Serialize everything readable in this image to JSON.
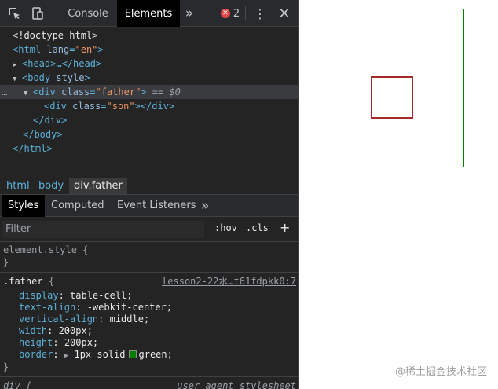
{
  "toolbar": {
    "tabs": [
      "Console",
      "Elements"
    ],
    "more": "»",
    "error_count": "2"
  },
  "dom": {
    "doctype": "<!doctype html>",
    "html_open_tag": "<html",
    "html_lang_attr": "lang",
    "html_lang_val": "\"en\"",
    "html_close_bracket": ">",
    "head_tag": "<head>…</head>",
    "body_open": "<body",
    "body_attr": "style",
    "body_close_bracket": ">",
    "div_open": "<div",
    "class_attr": "class",
    "father_val": "\"father\"",
    "gt": ">",
    "eq_marker": "== $0",
    "son_val": "\"son\"",
    "div_close_son": "></div>",
    "div_close": "</div>",
    "body_close": "</body>",
    "html_close": "</html>",
    "ellipsis": "…"
  },
  "breadcrumb": [
    "html",
    "body",
    "div.father"
  ],
  "styles_tabs": [
    "Styles",
    "Computed",
    "Event Listeners"
  ],
  "styles_more": "»",
  "filter": {
    "placeholder": "Filter",
    "hov": ":hov",
    "cls": ".cls",
    "plus": "+"
  },
  "rules": {
    "element_style": "element.style {",
    "close": "}",
    "father_selector": ".father",
    "open_brace": "{",
    "father_source": "lesson2-22水…t61fdpkk0:7",
    "props": [
      {
        "name": "display",
        "value": "table-cell;"
      },
      {
        "name": "text-align",
        "value": "-webkit-center;"
      },
      {
        "name": "vertical-align",
        "value": "middle;"
      },
      {
        "name": "width",
        "value": "200px;"
      },
      {
        "name": "height",
        "value": "200px;"
      }
    ],
    "border_name": "border",
    "border_value_a": "1px solid",
    "border_value_b": "green;",
    "div_selector": "div {",
    "ua_source": "user agent stylesheet"
  },
  "watermark": "@稀土掘金技术社区",
  "colors": {
    "father_border": "#008000",
    "son_border": "#a52a2a",
    "tag": "#5db0d7",
    "attr_value": "#f29766"
  }
}
